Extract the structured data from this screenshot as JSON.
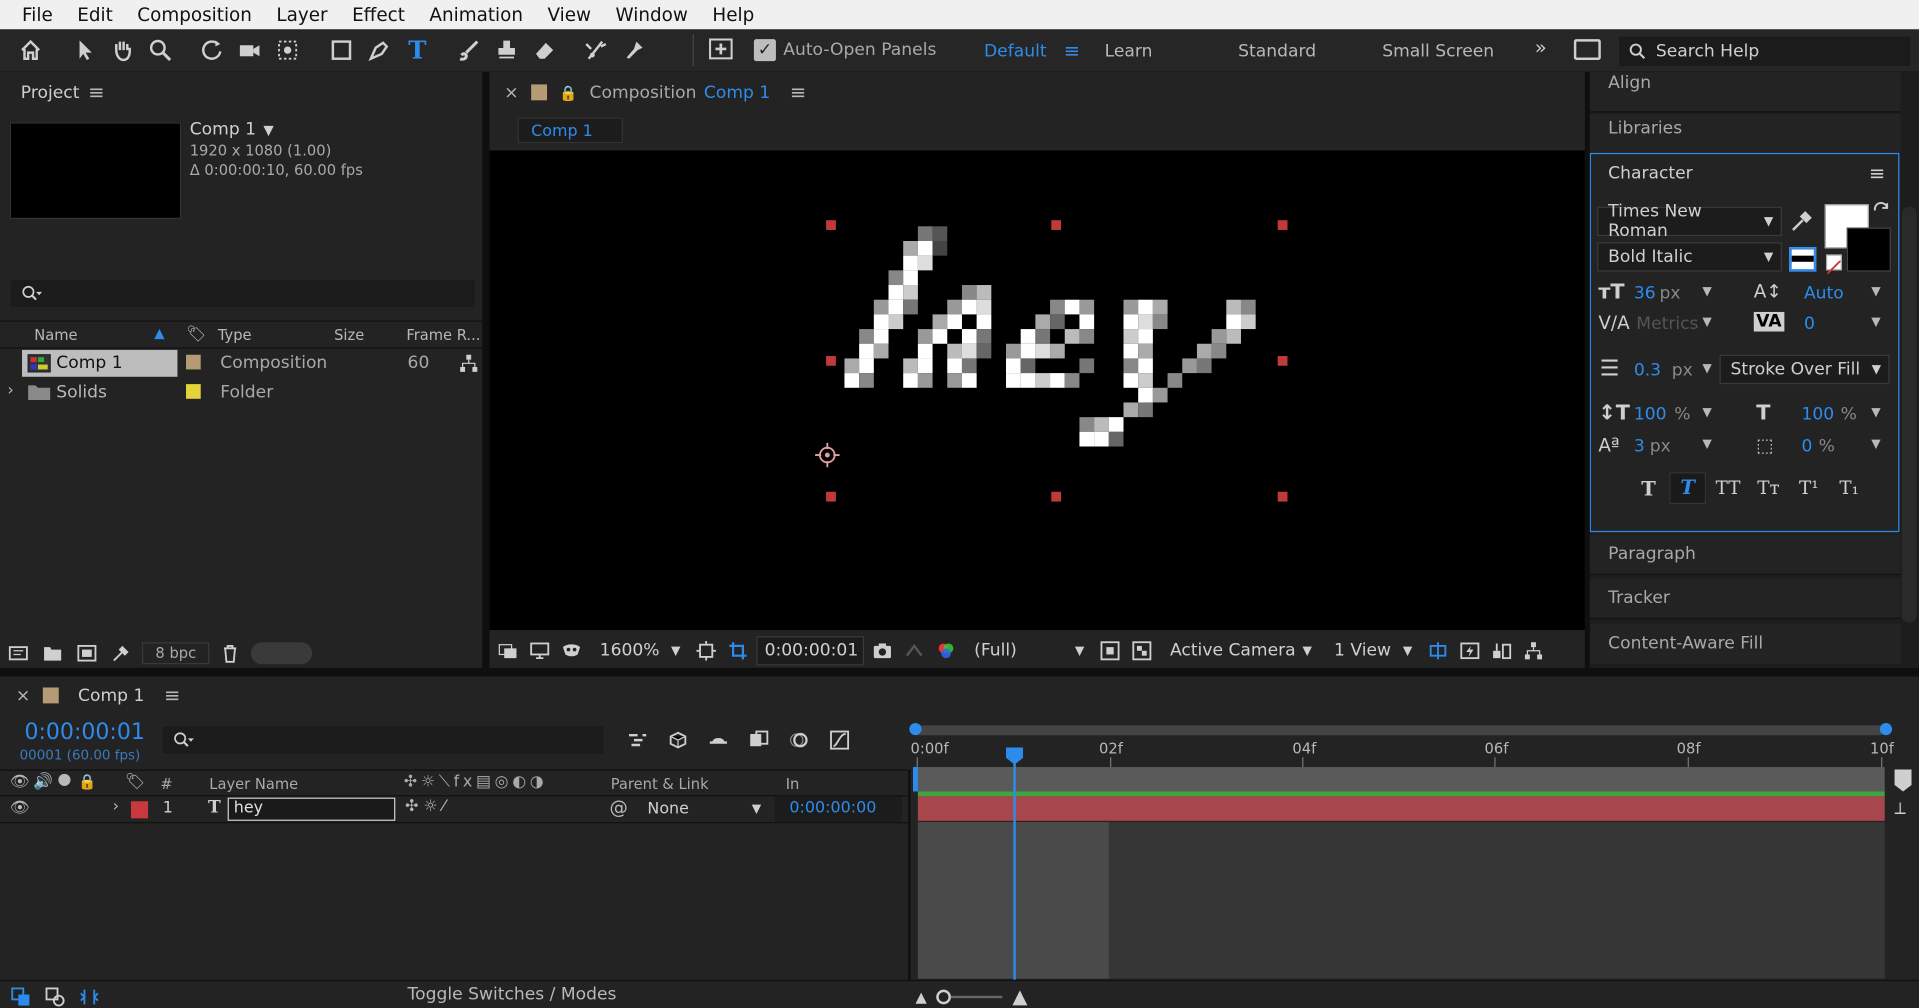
{
  "menu": [
    "File",
    "Edit",
    "Composition",
    "Layer",
    "Effect",
    "Animation",
    "View",
    "Window",
    "Help"
  ],
  "toolbar": {
    "auto_open": "Auto-Open Panels",
    "workspaces": [
      "Default",
      "Learn",
      "Standard",
      "Small Screen"
    ],
    "search_placeholder": "Search Help"
  },
  "project": {
    "title": "Project",
    "comp_name": "Comp 1",
    "comp_dims": "1920 x 1080 (1.00)",
    "comp_dur": "Δ 0:00:00:10, 60.00 fps",
    "columns": [
      "Name",
      "Type",
      "Size",
      "Frame R..."
    ],
    "items": [
      {
        "name": "Comp 1",
        "type": "Composition",
        "size": "",
        "fps": "60",
        "label_color": "#b59b74"
      },
      {
        "name": "Solids",
        "type": "Folder",
        "size": "",
        "fps": "",
        "label_color": "#e6d23a"
      }
    ],
    "bpc": "8 bpc"
  },
  "comp_panel": {
    "prefix": "Composition",
    "name": "Comp 1",
    "tab": "Comp 1",
    "zoom": "1600%",
    "time": "0:00:00:01",
    "resolution": "(Full)",
    "camera": "Active Camera",
    "views": "1 View",
    "text": "hey"
  },
  "right_panels": {
    "align": "Align",
    "libraries": "Libraries",
    "character": "Character",
    "paragraph": "Paragraph",
    "tracker": "Tracker",
    "caf": "Content-Aware Fill"
  },
  "character": {
    "font": "Times New Roman",
    "style": "Bold Italic",
    "size": "36",
    "size_unit": "px",
    "leading": "Auto",
    "kerning": "Metrics",
    "tracking": "0",
    "stroke": "0.3",
    "stroke_unit": "px",
    "stroke_mode": "Stroke Over Fill",
    "vscale": "100",
    "hscale": "100",
    "pct": "%",
    "baseline": "3",
    "baseline_unit": "px",
    "tsume": "0",
    "styles": [
      "T",
      "T",
      "TT",
      "Tт",
      "T¹",
      "T₁"
    ]
  },
  "timeline": {
    "title": "Comp 1",
    "time": "0:00:00:01",
    "frames": "00001 (60.00 fps)",
    "ruler": [
      "0:00f",
      "02f",
      "04f",
      "06f",
      "08f",
      "10f"
    ],
    "cols": {
      "hash": "#",
      "layer_name": "Layer Name",
      "parent": "Parent & Link",
      "in": "In"
    },
    "layer": {
      "num": "1",
      "name": "hey",
      "parent": "None",
      "in": "0:00:00:00"
    },
    "toggle": "Toggle Switches / Modes"
  },
  "colors": {
    "accent": "#2d8ceb",
    "layer_red": "#c9383d",
    "bar_red": "#a8474b"
  }
}
